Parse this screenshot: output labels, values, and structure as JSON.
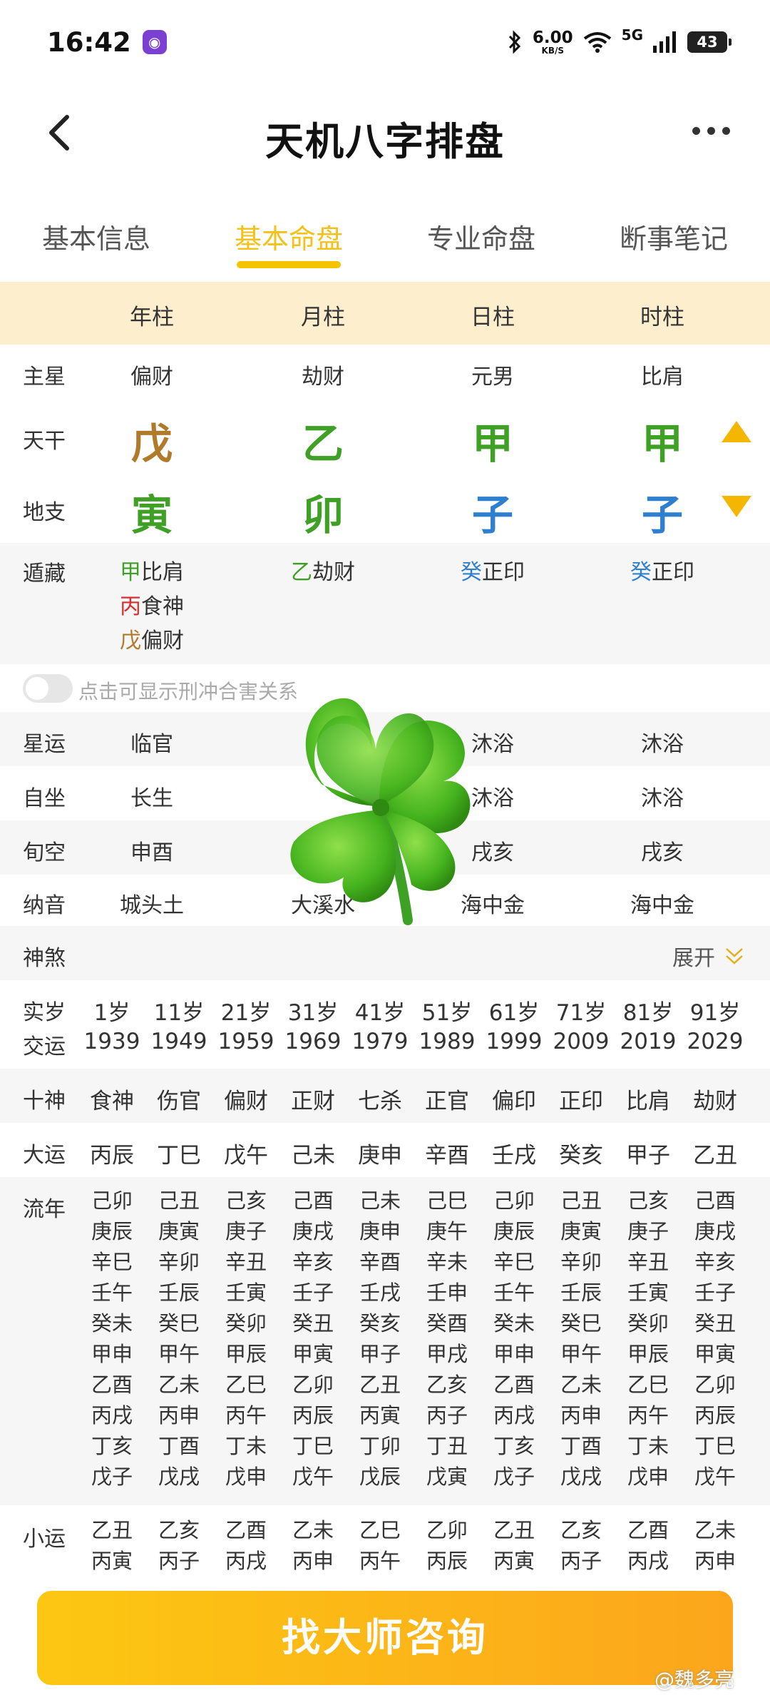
{
  "status": {
    "time": "16:42",
    "speed_value": "6.00",
    "speed_unit": "KB/S",
    "network": "5G",
    "battery": "43"
  },
  "header": {
    "title": "天机八字排盘"
  },
  "tabs": [
    "基本信息",
    "基本命盘",
    "专业命盘",
    "断事笔记"
  ],
  "active_tab": 1,
  "pillars": {
    "headers": [
      "年柱",
      "月柱",
      "日柱",
      "时柱"
    ]
  },
  "labels": {
    "zhuxing": "主星",
    "tiangan": "天干",
    "dizhi": "地支",
    "canggan": "遁藏",
    "xingyun": "星运",
    "zizuo": "自坐",
    "xunkong": "旬空",
    "nayin": "纳音",
    "shensha": "神煞",
    "shisui": "实岁",
    "jiaoyun": "交运",
    "shishen": "十神",
    "dayun": "大运",
    "liunian": "流年",
    "xiaoyun": "小运"
  },
  "zhuxing": [
    "偏财",
    "劫财",
    "元男",
    "比肩"
  ],
  "tiangan": [
    "戊",
    "乙",
    "甲",
    "甲"
  ],
  "dizhi": [
    "寅",
    "卯",
    "子",
    "子"
  ],
  "canggan": [
    [
      {
        "g": "甲",
        "s": "比肩",
        "c": "green"
      },
      {
        "g": "丙",
        "s": "食神",
        "c": "red"
      },
      {
        "g": "戊",
        "s": "偏财",
        "c": "brown"
      }
    ],
    [
      {
        "g": "乙",
        "s": "劫财",
        "c": "green"
      }
    ],
    [
      {
        "g": "癸",
        "s": "正印",
        "c": "blue"
      }
    ],
    [
      {
        "g": "癸",
        "s": "正印",
        "c": "blue"
      }
    ]
  ],
  "toggle_text": "点击可显示刑冲合害关系",
  "xingyun": [
    "临官",
    "",
    "沐浴",
    "沐浴"
  ],
  "zizuo": [
    "长生",
    "",
    "沐浴",
    "沐浴"
  ],
  "xunkong": [
    "申酉",
    "",
    "戌亥",
    "戌亥"
  ],
  "nayin": [
    "城头土",
    "大溪水",
    "海中金",
    "海中金"
  ],
  "expand_label": "展开",
  "ages": [
    "1岁",
    "11岁",
    "21岁",
    "31岁",
    "41岁",
    "51岁",
    "61岁",
    "71岁",
    "81岁",
    "91岁"
  ],
  "years": [
    "1939",
    "1949",
    "1959",
    "1969",
    "1979",
    "1989",
    "1999",
    "2009",
    "2019",
    "2029"
  ],
  "shishen": [
    "食神",
    "伤官",
    "偏财",
    "正财",
    "七杀",
    "正官",
    "偏印",
    "正印",
    "比肩",
    "劫财"
  ],
  "dayun": [
    "丙辰",
    "丁巳",
    "戊午",
    "己未",
    "庚申",
    "辛酉",
    "壬戌",
    "癸亥",
    "甲子",
    "乙丑"
  ],
  "liunian": [
    [
      "己卯",
      "庚辰",
      "辛巳",
      "壬午",
      "癸未",
      "甲申",
      "乙酉",
      "丙戌",
      "丁亥",
      "戊子"
    ],
    [
      "己丑",
      "庚寅",
      "辛卯",
      "壬辰",
      "癸巳",
      "甲午",
      "乙未",
      "丙申",
      "丁酉",
      "戊戌"
    ],
    [
      "己亥",
      "庚子",
      "辛丑",
      "壬寅",
      "癸卯",
      "甲辰",
      "乙巳",
      "丙午",
      "丁未",
      "戊申"
    ],
    [
      "己酉",
      "庚戌",
      "辛亥",
      "壬子",
      "癸丑",
      "甲寅",
      "乙卯",
      "丙辰",
      "丁巳",
      "戊午"
    ],
    [
      "己未",
      "庚申",
      "辛酉",
      "壬戌",
      "癸亥",
      "甲子",
      "乙丑",
      "丙寅",
      "丁卯",
      "戊辰"
    ],
    [
      "己巳",
      "庚午",
      "辛未",
      "壬申",
      "癸酉",
      "甲戌",
      "乙亥",
      "丙子",
      "丁丑",
      "戊寅"
    ],
    [
      "己卯",
      "庚辰",
      "辛巳",
      "壬午",
      "癸未",
      "甲申",
      "乙酉",
      "丙戌",
      "丁亥",
      "戊子"
    ],
    [
      "己丑",
      "庚寅",
      "辛卯",
      "壬辰",
      "癸巳",
      "甲午",
      "乙未",
      "丙申",
      "丁酉",
      "戊戌"
    ],
    [
      "己亥",
      "庚子",
      "辛丑",
      "壬寅",
      "癸卯",
      "甲辰",
      "乙巳",
      "丙午",
      "丁未",
      "戊申"
    ],
    [
      "己酉",
      "庚戌",
      "辛亥",
      "壬子",
      "癸丑",
      "甲寅",
      "乙卯",
      "丙辰",
      "丁巳",
      "戊午"
    ]
  ],
  "xiaoyun": [
    [
      "乙丑",
      "丙寅"
    ],
    [
      "乙亥",
      "丙子"
    ],
    [
      "乙酉",
      "丙戌"
    ],
    [
      "乙未",
      "丙申"
    ],
    [
      "乙巳",
      "丙午"
    ],
    [
      "乙卯",
      "丙辰"
    ],
    [
      "乙丑",
      "丙寅"
    ],
    [
      "乙亥",
      "丙子"
    ],
    [
      "乙酉",
      "丙戌"
    ],
    [
      "乙未",
      "丙申"
    ]
  ],
  "cta_label": "找大师咨询",
  "watermark": "@魏多亮",
  "colors": {
    "accent": "#f5c400",
    "header_bg": "#fdefce",
    "green": "#3ea024",
    "brown": "#b07a2a",
    "blue": "#2f7fcf",
    "red": "#d83030"
  }
}
